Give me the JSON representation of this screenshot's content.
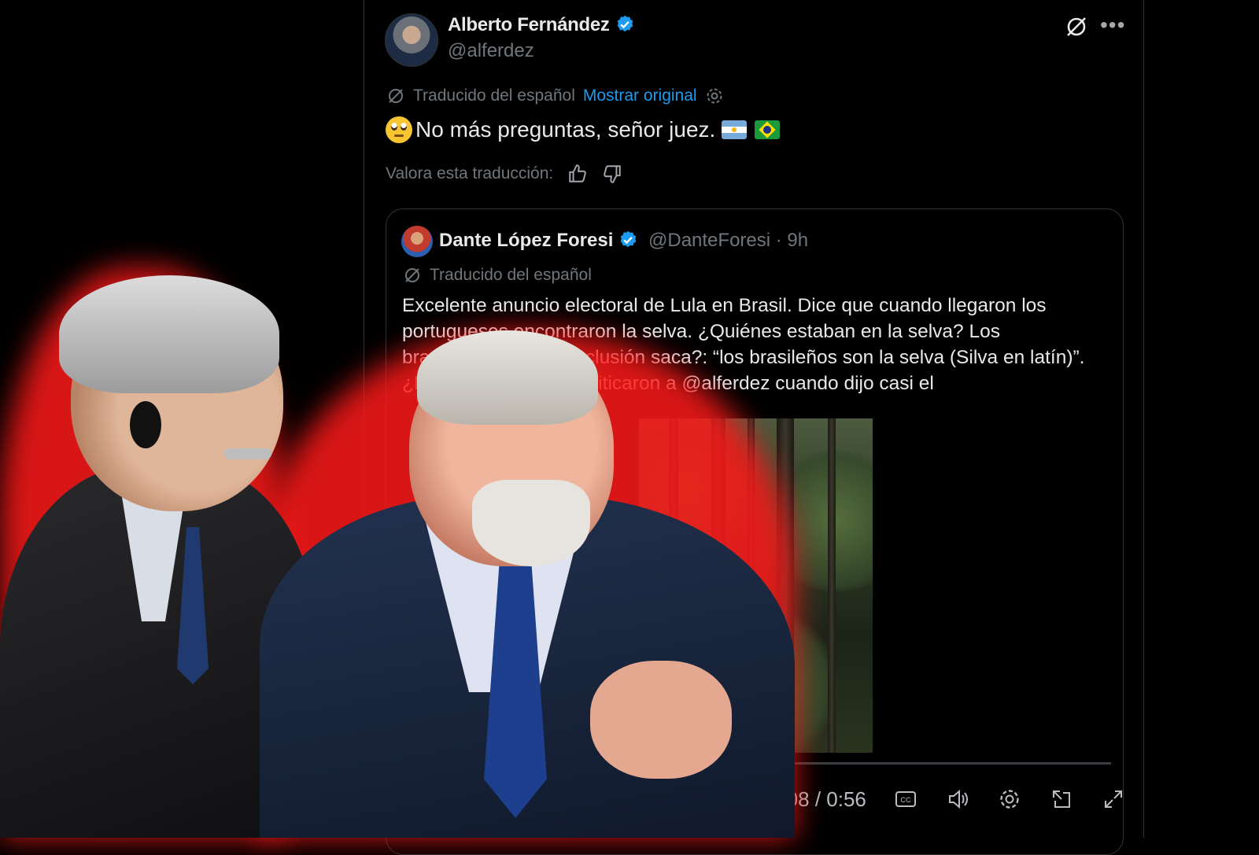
{
  "tweet": {
    "author_name": "Alberto Fernández",
    "author_handle": "@alferdez",
    "translated_label": "Traducido del español",
    "show_original": "Mostrar original",
    "text": "No más preguntas, señor juez.",
    "rate_label": "Valora esta traducción:"
  },
  "quoted_tweet": {
    "author_name": "Dante López Foresi",
    "author_handle": "@DanteForesi",
    "time": "· 9h",
    "translated_label": "Traducido del español",
    "body_lines": [
      "Excelente anuncio electoral de Lula en Brasil. Dice que cuando llegaron los",
      "portugueses encontraron la selva. ¿Quiénes estaban en la selva? Los",
      "brasileños. ¿Qué conclusión saca?: “los brasileños son la selva (Silva en latín)”.",
      "¿Recuerdan cuando criticaron a @alferdez cuando dijo casi el"
    ],
    "video": {
      "time_display": "0:08 / 0:56",
      "progress": 0.14
    }
  },
  "icons": [
    "verified-badge-icon",
    "grok-icon",
    "more-icon",
    "translate-icon",
    "settings-icon",
    "thumbs-up-icon",
    "thumbs-down-icon",
    "captions-icon",
    "volume-icon",
    "gear-icon",
    "pip-icon",
    "fullscreen-icon"
  ],
  "colors": {
    "accent": "#1d9bf0",
    "background": "#000000",
    "muted": "#71767b",
    "glow": "#ff1a1a"
  }
}
